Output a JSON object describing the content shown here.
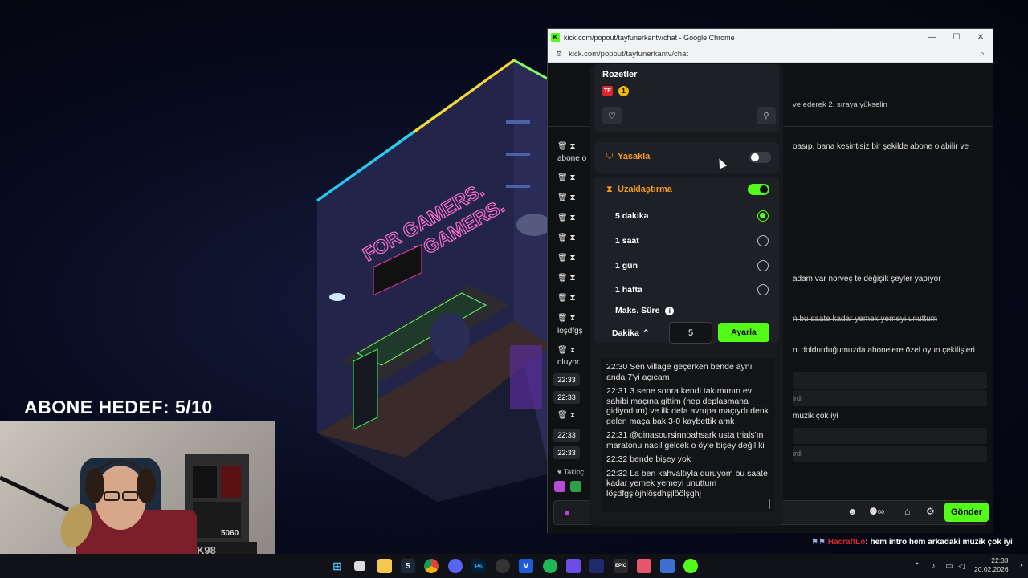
{
  "stream": {
    "abone_hedef": "ABONE HEDEF:  5/10",
    "neon_line1": "FOR GAMERS.",
    "neon_line2": "BY GAMERS.",
    "webcam_pc_label": "5060",
    "webcam_case_label": "K98",
    "overlay_user": "HacraftLo",
    "overlay_text": ": hem intro hem arkadaki müzik çok iyi"
  },
  "browser": {
    "favicon_letter": "K",
    "window_title": "kick.com/popout/tayfunerkantv/chat - Google Chrome",
    "url": "kick.com/popout/tayfunerkantv/chat",
    "minimize": "—",
    "maximize": "☐",
    "close": "✕"
  },
  "chat": {
    "rank_text": "ve ederek 2. sıraya yükselin",
    "msg1a": "oasıp, bana kesintisiz bir şekilde abone olabilir ve",
    "msg1b": "abone o",
    "msg2": "adam var norveç te değişik şeyler yapıyor",
    "msg3_struck": "n bu saate kadar yemek yemeyi unuttum",
    "msg3b": "löşdfgş",
    "msg4a": "ni doldurduğumuzda abonelere özel oyun çekilişleri",
    "msg4b": "oluyor.",
    "grey1": "irdı",
    "msg5": "müzik çok iyi",
    "grey2": "irdı",
    "time1": "22:33",
    "time2": "22:33",
    "time3": "22:33",
    "time4": "22:33",
    "followers_label": "Takipç",
    "send_button": "Gönder",
    "accent": "#53fc18"
  },
  "mod_panel": {
    "badges_title": "Rozetler",
    "badge_count": "1",
    "ban_label": "Yasakla",
    "ban_enabled": false,
    "timeout_label": "Uzaklaştırma",
    "timeout_enabled": true,
    "options": [
      "5 dakika",
      "1 saat",
      "1 gün",
      "1 hafta"
    ],
    "selected_option": "5 dakika",
    "max_duration_label": "Maks. Süre",
    "unit_select": "Dakika",
    "duration_value": "5",
    "apply_button": "Ayarla",
    "messages": [
      {
        "time": "22:30",
        "text": "Sen village geçerken bende aynı anda 7'yi açıcam"
      },
      {
        "time": "22:31",
        "text": "3 sene sonra kendi takımımın ev sahibi maçına gittim (hep deplasmana gidiyodum) ve ilk defa avrupa maçıydı denk gelen maça bak 3-0 kaybettik amk"
      },
      {
        "time": "22:31",
        "text": "@dinasoursinnoahsark usta trials'ın maratonu nasıl gelcek o öyle bişey değil ki"
      },
      {
        "time": "22:32",
        "text": "bende bişey yok"
      },
      {
        "time": "22:32",
        "text": "La ben kahvaltıyla duruyom bu saate kadar yemek yemeyi unuttum löşdfgşlöjhlöşdhşjlöölşghj"
      }
    ]
  },
  "taskbar": {
    "clock_time": "22:33",
    "clock_date": "20.02.2026"
  }
}
